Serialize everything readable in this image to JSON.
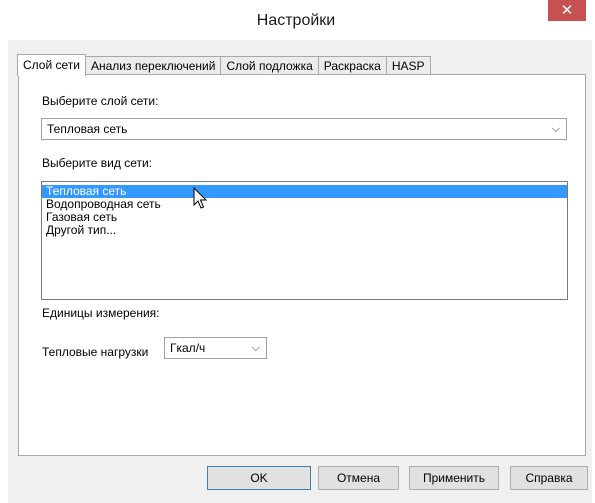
{
  "window": {
    "title": "Настройки",
    "close_glyph": "✕"
  },
  "tabs": [
    {
      "label": "Слой сети",
      "active": true
    },
    {
      "label": "Анализ переключений",
      "active": false
    },
    {
      "label": "Слой подложка",
      "active": false
    },
    {
      "label": "Раскраска",
      "active": false
    },
    {
      "label": "HASP",
      "active": false
    }
  ],
  "layer_select": {
    "label": "Выберите слой сети:",
    "value": "Тепловая сеть",
    "chevron": "⌵"
  },
  "network_type": {
    "label": "Выберите вид сети:",
    "items": [
      "Тепловая сеть",
      "Водопроводная сеть",
      "Газовая сеть",
      "Другой тип..."
    ],
    "selected_index": 0
  },
  "units": {
    "label": "Единицы измерения:",
    "heat_load_label": "Тепловые нагрузки",
    "heat_load_value": "Гкал/ч",
    "chevron": "⌵"
  },
  "buttons": {
    "ok": "OK",
    "cancel": "Отмена",
    "apply": "Применить",
    "help": "Справка"
  },
  "colors": {
    "selection": "#3399ff",
    "close_button": "#c75050"
  }
}
